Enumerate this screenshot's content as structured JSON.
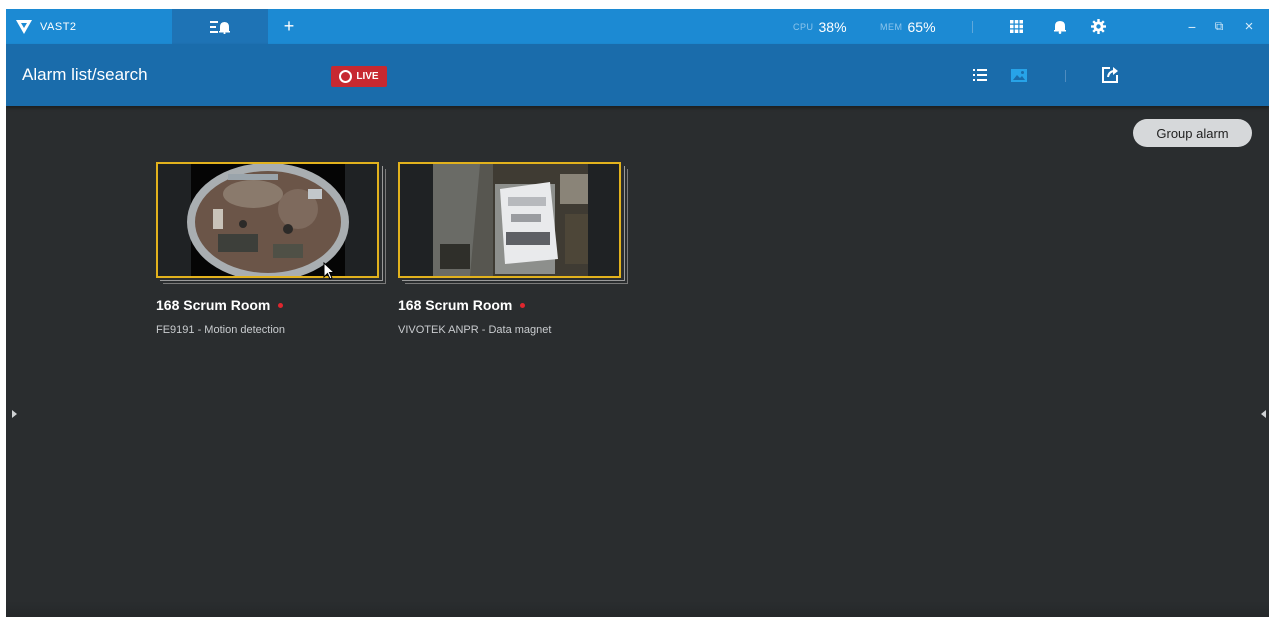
{
  "titlebar": {
    "app_name": "VAST2",
    "alarm_tab_icon": "alarm-list-icon",
    "add_tab_label": "+",
    "cpu_label": "CPU",
    "cpu_value": "38%",
    "mem_label": "MEM",
    "mem_value": "65%",
    "icons": [
      "grid-icon",
      "bell-icon",
      "settings-icon"
    ],
    "window_controls": {
      "minimize": "−",
      "restore": "⧉",
      "close": "×"
    }
  },
  "toolbar": {
    "title": "Alarm list/search",
    "live_label": "LIVE",
    "icons": [
      "list-view-icon",
      "thumbnail-view-icon",
      "export-icon"
    ]
  },
  "content": {
    "group_alarm_label": "Group alarm",
    "cards": [
      {
        "title": "168 Scrum Room",
        "subtitle": "FE9191 - Motion detection",
        "thumbnail": "fisheye-camera-view"
      },
      {
        "title": "168 Scrum Room",
        "subtitle": "VIVOTEK ANPR - Data magnet",
        "thumbnail": "license-plate-camera-view"
      }
    ]
  },
  "colors": {
    "titlebar": "#1c8ad3",
    "toolbar": "#1a6cab",
    "background": "#2a2d2f",
    "live_badge": "#c72931",
    "card_border": "#e2b21d",
    "alarm_dot": "#e0262e"
  }
}
